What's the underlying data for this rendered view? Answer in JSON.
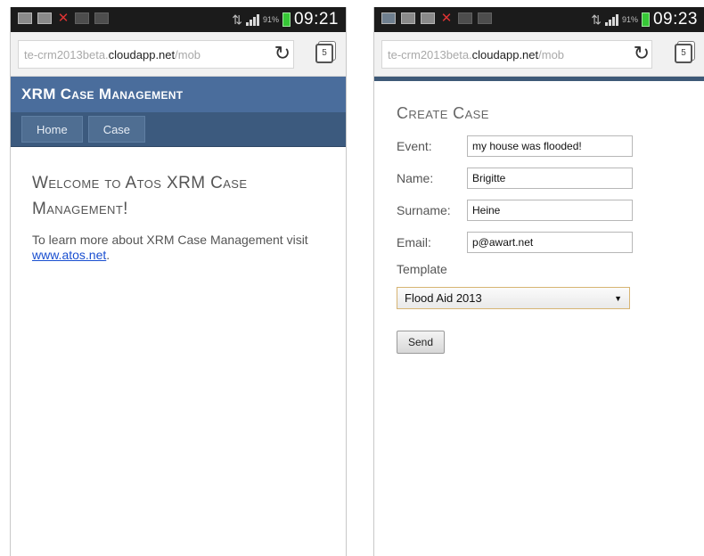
{
  "left_phone": {
    "status_time": "09:21",
    "battery_pct": "91%",
    "url": {
      "prefix": "te-crm2013beta.",
      "host": "cloudapp.net",
      "path": "/mob"
    },
    "tab_count": "5",
    "app_title": "XRM Case Management",
    "nav": [
      "Home",
      "Case"
    ],
    "welcome_heading": "Welcome to Atos XRM Case Management!",
    "info_text": "To learn more about XRM Case Management visit ",
    "info_link": "www.atos.net",
    "info_after": "."
  },
  "right_phone": {
    "status_time": "09:23",
    "battery_pct": "91%",
    "url": {
      "prefix": "te-crm2013beta.",
      "host": "cloudapp.net",
      "path": "/mob"
    },
    "tab_count": "5",
    "form_title": "Create Case",
    "fields": [
      {
        "label": "Event:",
        "value": "my house was flooded!"
      },
      {
        "label": "Name:",
        "value": "Brigitte"
      },
      {
        "label": "Surname:",
        "value": "Heine"
      },
      {
        "label": "Email:",
        "value": "p@awart.net"
      }
    ],
    "template_label": "Template",
    "template_value": "Flood Aid 2013",
    "send_label": "Send"
  },
  "colors": {
    "header": "#4a6d9c",
    "nav": "#3c5a7e",
    "link": "#1a4fd0",
    "statusbar": "#1b1b1b"
  }
}
